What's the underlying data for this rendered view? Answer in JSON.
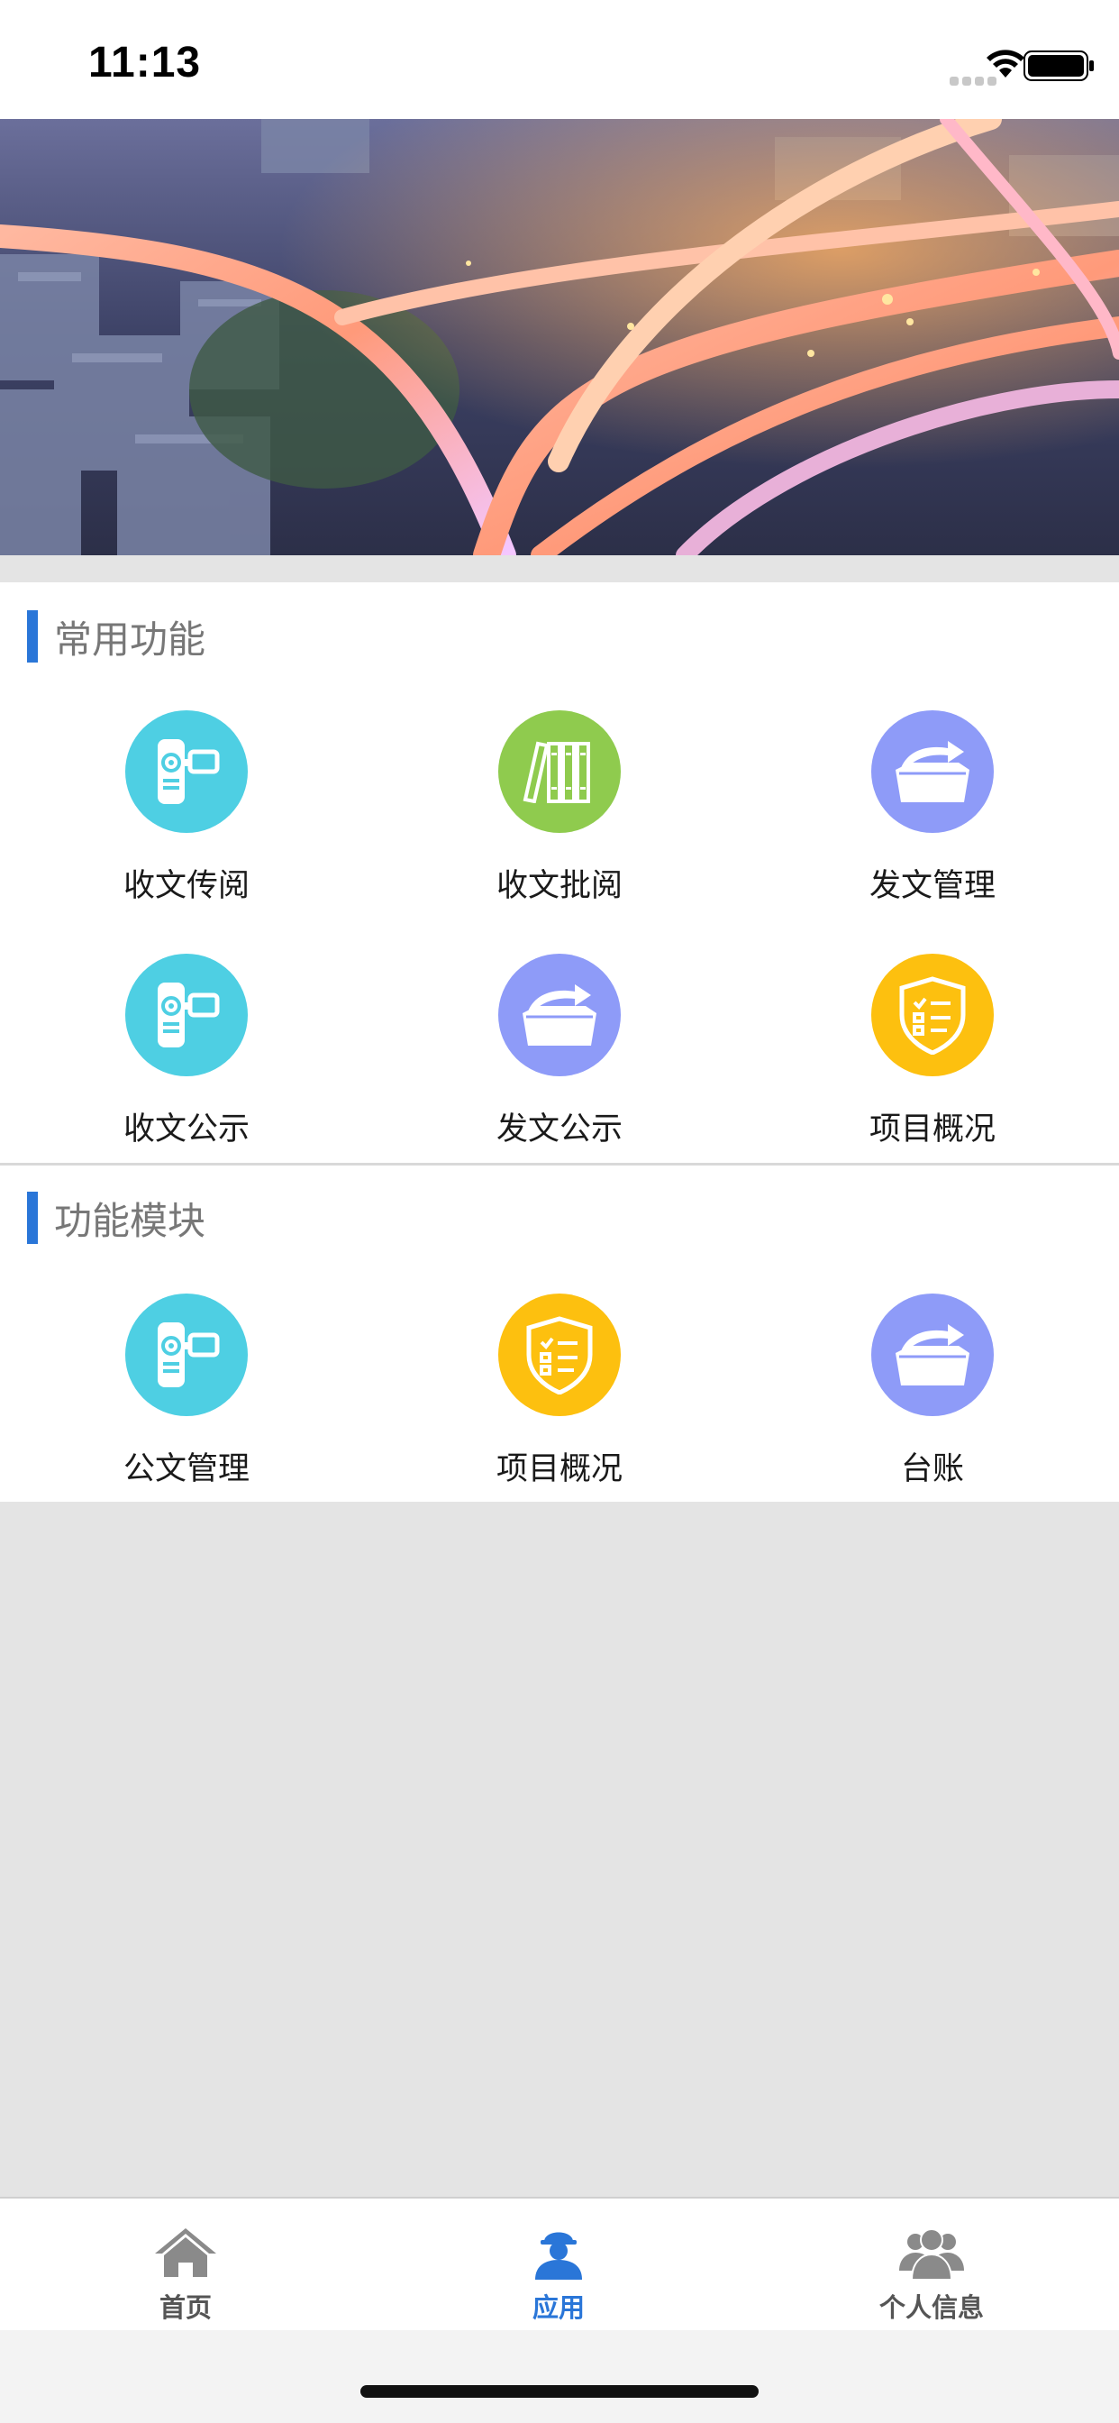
{
  "status_bar": {
    "time": "11:13"
  },
  "sections": {
    "common": {
      "title": "常用功能",
      "items": [
        {
          "label": "收文传阅",
          "icon": "camcorder-icon",
          "color": "#4ecfe3"
        },
        {
          "label": "收文批阅",
          "icon": "books-icon",
          "color": "#8fcb4e"
        },
        {
          "label": "发文管理",
          "icon": "folder-send-icon",
          "color": "#8e9bf8"
        },
        {
          "label": "收文公示",
          "icon": "camcorder-icon",
          "color": "#4ecfe3"
        },
        {
          "label": "发文公示",
          "icon": "folder-send-icon",
          "color": "#8e9bf8"
        },
        {
          "label": "项目概况",
          "icon": "shield-checklist-icon",
          "color": "#fdc00f"
        }
      ]
    },
    "modules": {
      "title": "功能模块",
      "items": [
        {
          "label": "公文管理",
          "icon": "camcorder-icon",
          "color": "#4ecfe3"
        },
        {
          "label": "项目概况",
          "icon": "shield-checklist-icon",
          "color": "#fdc00f"
        },
        {
          "label": "台账",
          "icon": "folder-send-icon",
          "color": "#8e9bf8"
        }
      ]
    }
  },
  "tab_bar": {
    "tabs": [
      {
        "label": "首页",
        "icon": "home-icon",
        "active": false
      },
      {
        "label": "应用",
        "icon": "worker-icon",
        "active": true
      },
      {
        "label": "个人信息",
        "icon": "users-icon",
        "active": false
      }
    ]
  },
  "colors": {
    "accent": "#2a76d8",
    "page_bg": "#e4e4e4"
  }
}
